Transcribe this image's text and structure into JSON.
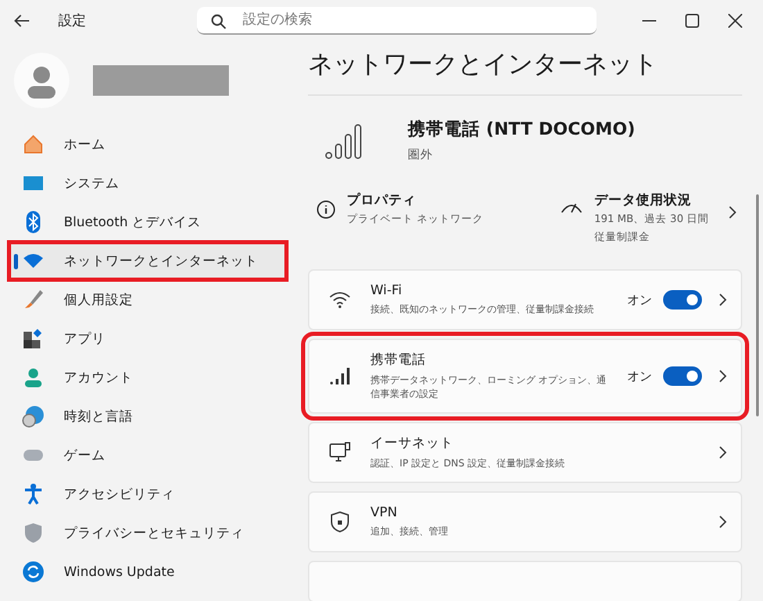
{
  "window": {
    "title": "設定"
  },
  "search": {
    "placeholder": "設定の検索"
  },
  "sidebar": {
    "items": [
      {
        "label": "ホーム",
        "kind": "home",
        "selected": false,
        "highlighted": false
      },
      {
        "label": "システム",
        "kind": "system",
        "selected": false,
        "highlighted": false
      },
      {
        "label": "Bluetooth とデバイス",
        "kind": "bluetooth",
        "selected": false,
        "highlighted": false
      },
      {
        "label": "ネットワークとインターネット",
        "kind": "wifi",
        "selected": true,
        "highlighted": true
      },
      {
        "label": "個人用設定",
        "kind": "brush",
        "selected": false,
        "highlighted": false
      },
      {
        "label": "アプリ",
        "kind": "apps",
        "selected": false,
        "highlighted": false
      },
      {
        "label": "アカウント",
        "kind": "account",
        "selected": false,
        "highlighted": false
      },
      {
        "label": "時刻と言語",
        "kind": "time",
        "selected": false,
        "highlighted": false
      },
      {
        "label": "ゲーム",
        "kind": "game",
        "selected": false,
        "highlighted": false
      },
      {
        "label": "アクセシビリティ",
        "kind": "access",
        "selected": false,
        "highlighted": false
      },
      {
        "label": "プライバシーとセキュリティ",
        "kind": "shield",
        "selected": false,
        "highlighted": false
      },
      {
        "label": "Windows Update",
        "kind": "update",
        "selected": false,
        "highlighted": false
      }
    ]
  },
  "page": {
    "title": "ネットワークとインターネット",
    "header": {
      "title": "携帯電話 (NTT DOCOMO)",
      "status": "圏外"
    },
    "info": [
      {
        "kind": "info",
        "title": "プロパティ",
        "subtitle": "プライベート ネットワーク"
      },
      {
        "kind": "gauge",
        "title": "データ使用状況",
        "subtitle": "191 MB、過去 30 日間",
        "note": "従量制課金"
      }
    ],
    "cards": [
      {
        "kind": "wifi",
        "title": "Wi-Fi",
        "subtitle": "接続、既知のネットワークの管理、従量制課金接続",
        "toggle_label": "オン",
        "on": true,
        "highlighted": false
      },
      {
        "kind": "signal",
        "title": "携帯電話",
        "subtitle": "携帯データネットワーク、ローミング オプション、通信事業者の設定",
        "toggle_label": "オン",
        "on": true,
        "highlighted": true
      },
      {
        "kind": "ethernet",
        "title": "イーサネット",
        "subtitle": "認証、IP 設定と DNS 設定、従量制課金接続",
        "highlighted": false
      },
      {
        "kind": "vpn",
        "title": "VPN",
        "subtitle": "追加、接続、管理",
        "highlighted": false
      }
    ]
  }
}
